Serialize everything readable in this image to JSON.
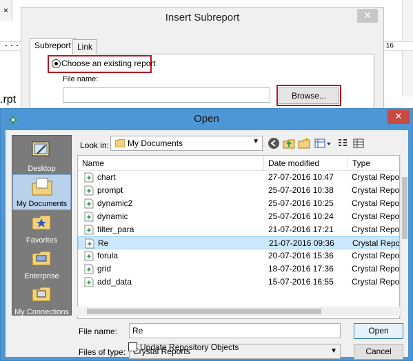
{
  "background": {
    "tab_glyph": "×",
    "ruler_number": "16",
    "rpt_text": ".rpt"
  },
  "subreport_dialog": {
    "title": "Insert Subreport",
    "close_glyph": "✕",
    "tabs": [
      {
        "label": "Subreport"
      },
      {
        "label": "Link"
      }
    ],
    "radio_label": "Choose an existing report",
    "file_name_label": "File name:",
    "file_name_value": "",
    "browse_label": "Browse..."
  },
  "open_dialog": {
    "title": "Open",
    "close_glyph": "✕",
    "places": [
      {
        "label": "Desktop",
        "icon": "desktop-icon"
      },
      {
        "label": "My Documents",
        "icon": "my-documents-icon"
      },
      {
        "label": "Favorites",
        "icon": "favorites-icon"
      },
      {
        "label": "Enterprise",
        "icon": "enterprise-icon"
      },
      {
        "label": "My Connections",
        "icon": "my-connections-icon"
      }
    ],
    "look_in_label": "Look in:",
    "look_in_value": "My Documents",
    "columns": {
      "name": "Name",
      "date": "Date modified",
      "type": "Type"
    },
    "files": [
      {
        "name": "chart",
        "date": "27-07-2016 10:47",
        "type": "Crystal Report"
      },
      {
        "name": "prompt",
        "date": "25-07-2016 10:38",
        "type": "Crystal Report"
      },
      {
        "name": "dynamic2",
        "date": "25-07-2016 10:25",
        "type": "Crystal Report"
      },
      {
        "name": "dynamic",
        "date": "25-07-2016 10:24",
        "type": "Crystal Report"
      },
      {
        "name": "filter_para",
        "date": "21-07-2016 17:21",
        "type": "Crystal Report"
      },
      {
        "name": "Re",
        "date": "21-07-2016 09:36",
        "type": "Crystal Report"
      },
      {
        "name": "forula",
        "date": "20-07-2016 15:36",
        "type": "Crystal Report"
      },
      {
        "name": "grid",
        "date": "18-07-2016 17:36",
        "type": "Crystal Report"
      },
      {
        "name": "add_data",
        "date": "15-07-2016 16:55",
        "type": "Crystal Report"
      }
    ],
    "file_name_label": "File name:",
    "file_name_value": "Re",
    "files_of_type_label": "Files of type:",
    "files_of_type_value": "Crystal Reports",
    "open_label": "Open",
    "cancel_label": "Cancel",
    "update_repo_label": "Update Repository Objects",
    "colors": {
      "title_bar": "#4e97d6",
      "selected_row": "#cce8ff",
      "highlight_border": "#b0191e"
    }
  }
}
